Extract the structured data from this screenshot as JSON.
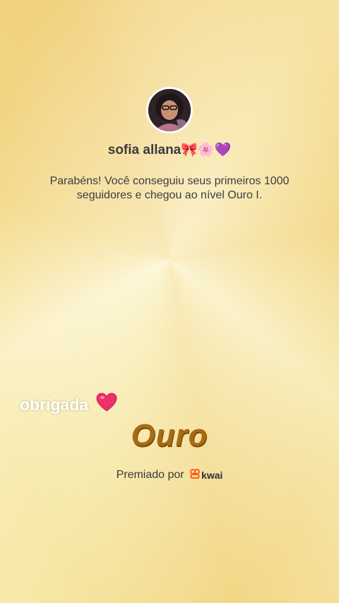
{
  "profile": {
    "username": "sofia allana",
    "username_emojis": "🎀🌸💜"
  },
  "message": "Parabéns! Você conseguiu seus primeiros 1000 seguidores e chegou ao nível Ouro I.",
  "caption": {
    "text": "obrigada"
  },
  "level": {
    "name": "Ouro"
  },
  "footer": {
    "awarded_by": "Premiado por",
    "brand": "kwai"
  },
  "colors": {
    "level_text": "#a86a12",
    "brand_orange": "#ff5a1f",
    "heart": "#f0306a"
  }
}
